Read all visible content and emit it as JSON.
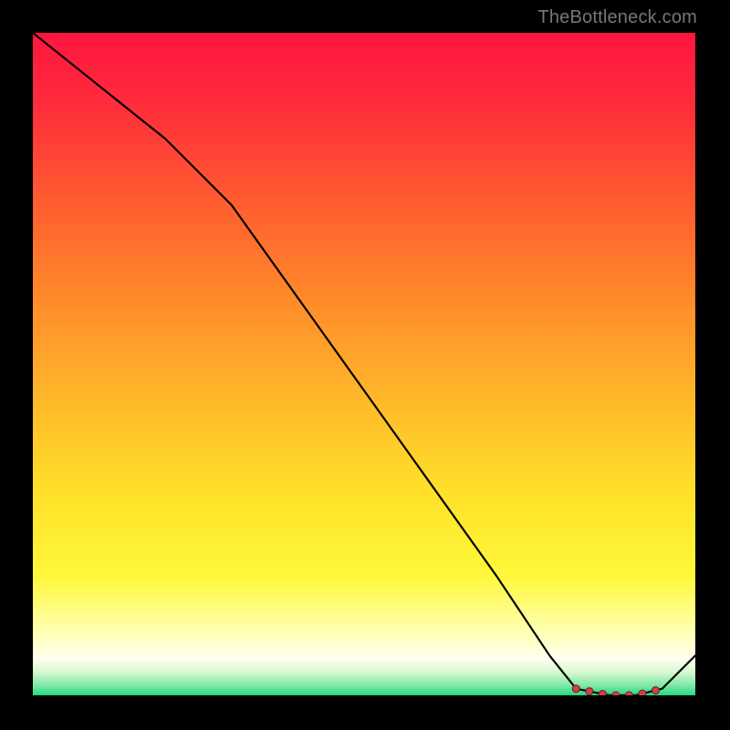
{
  "attribution": "TheBottleneck.com",
  "colors": {
    "background": "#000000",
    "curve": "#000000",
    "marker_fill": "#cc4444",
    "marker_stroke": "#7a1f1f",
    "attribution_text": "#777777"
  },
  "gradient_stops": [
    {
      "offset": 0.0,
      "color": "#ff153f"
    },
    {
      "offset": 0.1,
      "color": "#ff2a3c"
    },
    {
      "offset": 0.25,
      "color": "#ff5a30"
    },
    {
      "offset": 0.4,
      "color": "#ff8a2a"
    },
    {
      "offset": 0.55,
      "color": "#ffb72a"
    },
    {
      "offset": 0.7,
      "color": "#ffe22a"
    },
    {
      "offset": 0.82,
      "color": "#fff83a"
    },
    {
      "offset": 0.9,
      "color": "#ffffae"
    },
    {
      "offset": 0.945,
      "color": "#fffff0"
    },
    {
      "offset": 0.965,
      "color": "#d8f8d0"
    },
    {
      "offset": 0.985,
      "color": "#7fe8a8"
    },
    {
      "offset": 1.0,
      "color": "#20d97f"
    }
  ],
  "chart_data": {
    "type": "line",
    "title": "",
    "xlabel": "",
    "ylabel": "",
    "xlim": [
      0,
      100
    ],
    "ylim": [
      0,
      100
    ],
    "x": [
      0,
      10,
      20,
      30,
      40,
      50,
      60,
      70,
      78,
      82,
      87,
      91,
      95,
      100
    ],
    "values": [
      100,
      92,
      84,
      74,
      60,
      46,
      32,
      18,
      6,
      1,
      0,
      0,
      1,
      6
    ],
    "markers_x": [
      82,
      84,
      86,
      88,
      90,
      92,
      94
    ]
  }
}
